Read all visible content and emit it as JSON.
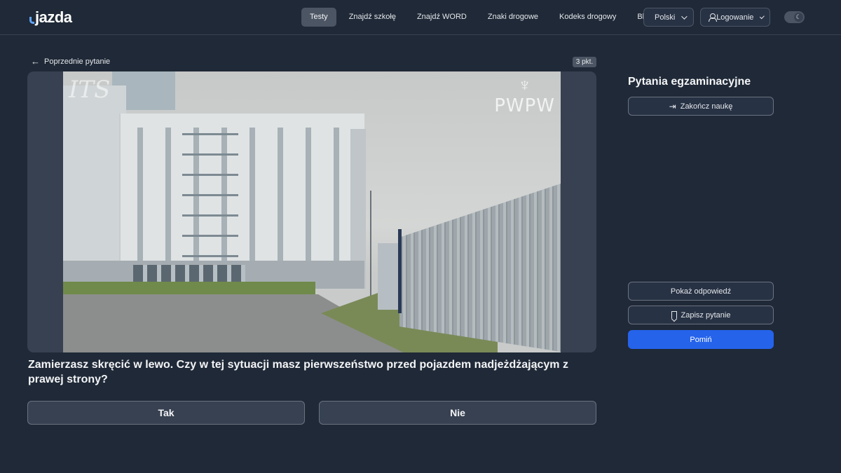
{
  "header": {
    "logo_text": "jazda",
    "nav": [
      {
        "label": "Testy",
        "active": true
      },
      {
        "label": "Znajdź szkołę",
        "active": false
      },
      {
        "label": "Znajdź WORD",
        "active": false
      },
      {
        "label": "Znaki drogowe",
        "active": false
      },
      {
        "label": "Kodeks drogowy",
        "active": false
      },
      {
        "label": "Blog",
        "active": false
      }
    ],
    "language": "Polski",
    "login": "Logowanie",
    "theme_icon": "moon-icon"
  },
  "question": {
    "back_label": "Poprzednie pytanie",
    "points": "3 pkt.",
    "text": "Zamierzasz skręcić w lewo. Czy w tej sytuacji masz pierwszeństwo przed pojazdem nadjeżdżającym z prawej strony?",
    "watermark_left": "ITS",
    "watermark_right": "PWPW",
    "answers": {
      "yes": "Tak",
      "no": "Nie"
    }
  },
  "sidebar": {
    "title": "Pytania egzaminacyjne",
    "finish": "Zakończ naukę",
    "show_answer": "Pokaż odpowiedź",
    "save_question": "Zapisz pytanie",
    "skip": "Pomiń"
  },
  "colors": {
    "background": "#1f2937",
    "accent": "#2563eb"
  }
}
